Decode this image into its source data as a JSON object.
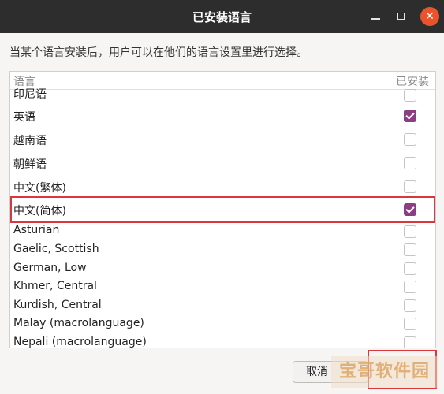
{
  "window": {
    "title": "已安装语言"
  },
  "description": "当某个语言安装后，用户可以在他们的语言设置里进行选择。",
  "columns": {
    "language": "语言",
    "installed": "已安装"
  },
  "languages": [
    {
      "label": "印尼语",
      "checked": false,
      "partial": true
    },
    {
      "label": "英语",
      "checked": true
    },
    {
      "label": "越南语",
      "checked": false
    },
    {
      "label": "朝鲜语",
      "checked": false
    },
    {
      "label": "中文(繁体)",
      "checked": false
    },
    {
      "label": "中文(简体)",
      "checked": true,
      "selected": true
    },
    {
      "label": "Asturian",
      "checked": false
    },
    {
      "label": "Gaelic, Scottish",
      "checked": false
    },
    {
      "label": "German, Low",
      "checked": false
    },
    {
      "label": "Khmer, Central",
      "checked": false
    },
    {
      "label": "Kurdish, Central",
      "checked": false
    },
    {
      "label": "Malay (macrolanguage)",
      "checked": false
    },
    {
      "label": "Nepali (macrolanguage)",
      "checked": false
    }
  ],
  "buttons": {
    "cancel": "取消"
  },
  "watermark": "宝哥软件园",
  "colors": {
    "accent": "#8d3d84",
    "highlight": "#d9363e",
    "close": "#e9542d"
  }
}
